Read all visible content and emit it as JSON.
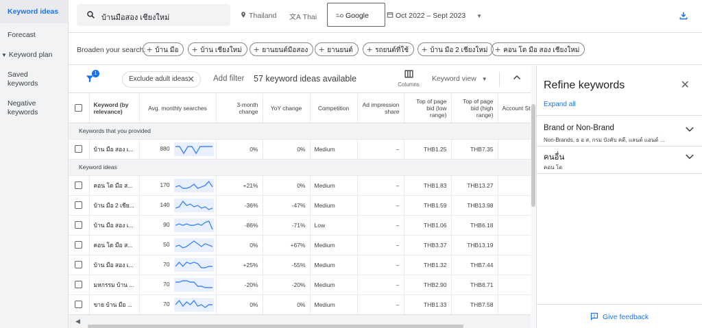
{
  "sidebar": {
    "items": [
      {
        "label": "Keyword ideas",
        "active": true
      },
      {
        "label": "Forecast"
      },
      {
        "label": "Keyword plan"
      },
      {
        "label": "Saved keywords"
      },
      {
        "label": "Negative keywords"
      }
    ]
  },
  "topbar": {
    "search_value": "บ้านมือสอง เชียงใหม่",
    "location": "Thailand",
    "language": "Thai",
    "network": "Google",
    "date_range": "Oct 2022 – Sept 2023"
  },
  "broaden": {
    "label": "Broaden your search:",
    "chips": [
      "บ้าน มือ",
      "บ้าน เชียงใหม่",
      "ยานยนต์มือสอง",
      "ยานยนต์",
      "รถยนต์ที่ใช้",
      "บ้าน มือ 2 เชียงใหม่",
      "คอน โด มือ สอง เชียงใหม่"
    ]
  },
  "filterbar": {
    "badge": "1",
    "exclude_pill": "Exclude adult ideas",
    "add_filter": "Add filter",
    "count_text": "57 keyword ideas available",
    "columns_label": "Columns",
    "view_label": "Keyword view"
  },
  "table": {
    "headers": {
      "keyword": "Keyword (by relevance)",
      "avg": "Avg. monthly searches",
      "three_month": "3-month change",
      "yoy": "YoY change",
      "competition": "Competition",
      "ad_share": "Ad impression share",
      "bid_low": "Top of page bid (low range)",
      "bid_high": "Top of page bid (high range)",
      "account": "Account St"
    },
    "section_provided": "Keywords that you provided",
    "section_ideas": "Keyword ideas",
    "provided_rows": [
      {
        "keyword": "บ้าน มือ สอง เ...",
        "avg": "880",
        "three_month": "0%",
        "yoy": "0%",
        "competition": "Medium",
        "ad_share": "–",
        "bid_low": "THB1.25",
        "bid_high": "THB7.35",
        "trend": [
          6,
          6,
          1,
          6,
          6,
          1,
          6,
          6,
          6,
          6
        ]
      }
    ],
    "idea_rows": [
      {
        "keyword": "คอน โด มือ ส...",
        "avg": "170",
        "three_month": "+21%",
        "yoy": "0%",
        "competition": "Medium",
        "ad_share": "–",
        "bid_low": "THB1.83",
        "bid_high": "THB13.27",
        "trend": [
          3,
          4,
          2,
          2,
          3,
          5,
          2,
          3,
          4,
          7,
          3
        ]
      },
      {
        "keyword": "บ้าน มือ 2 เชีย...",
        "avg": "140",
        "three_month": "-36%",
        "yoy": "-47%",
        "competition": "Medium",
        "ad_share": "–",
        "bid_low": "THB1.59",
        "bid_high": "THB13.98",
        "trend": [
          2,
          3,
          7,
          4,
          5,
          3,
          4,
          2,
          3,
          1,
          2
        ]
      },
      {
        "keyword": "บ้าน มือ สอง เ...",
        "avg": "90",
        "three_month": "-86%",
        "yoy": "-71%",
        "competition": "Low",
        "ad_share": "–",
        "bid_low": "THB1.06",
        "bid_high": "THB6.18",
        "trend": [
          4,
          5,
          4,
          5,
          4,
          4,
          5,
          4,
          6,
          7,
          1
        ]
      },
      {
        "keyword": "คอน โด มือ ส...",
        "avg": "50",
        "three_month": "0%",
        "yoy": "+67%",
        "competition": "Medium",
        "ad_share": "–",
        "bid_low": "THB3.37",
        "bid_high": "THB13.19",
        "trend": [
          3,
          4,
          2,
          3,
          5,
          7,
          5,
          3,
          5,
          4,
          3
        ]
      },
      {
        "keyword": "บ้าน มือ สอง เ...",
        "avg": "70",
        "three_month": "+25%",
        "yoy": "-55%",
        "competition": "Medium",
        "ad_share": "–",
        "bid_low": "THB1.32",
        "bid_high": "THB7.44",
        "trend": [
          3,
          6,
          3,
          6,
          5,
          6,
          5,
          2,
          2,
          3,
          3
        ]
      },
      {
        "keyword": "มหกรรม บ้าน ...",
        "avg": "70",
        "three_month": "-20%",
        "yoy": "-20%",
        "competition": "Medium",
        "ad_share": "–",
        "bid_low": "THB2.90",
        "bid_high": "THB8.71",
        "trend": [
          6,
          6,
          7,
          7,
          6,
          6,
          3,
          3,
          2,
          2,
          2
        ]
      },
      {
        "keyword": "ขาย บ้าน มือ ...",
        "avg": "70",
        "three_month": "0%",
        "yoy": "0%",
        "competition": "Medium",
        "ad_share": "–",
        "bid_low": "THB1.33",
        "bid_high": "THB7.58",
        "trend": [
          4,
          7,
          3,
          6,
          4,
          7,
          3,
          4,
          2,
          4,
          4
        ]
      }
    ]
  },
  "refine": {
    "title": "Refine keywords",
    "expand_all": "Expand all",
    "groups": [
      {
        "heading": "Brand or Non-Brand",
        "sub": "Non-Brands, ธ อ ส, กรม บังคับ คดี, แลนด์ แอนด์ ..."
      },
      {
        "heading": "คนอื่น",
        "sub": "คอน โด"
      }
    ],
    "feedback": "Give feedback"
  },
  "colors": {
    "accent": "#1a73e8",
    "trend_line": "#4285f4",
    "trend_fill": "#e8f0fe"
  }
}
